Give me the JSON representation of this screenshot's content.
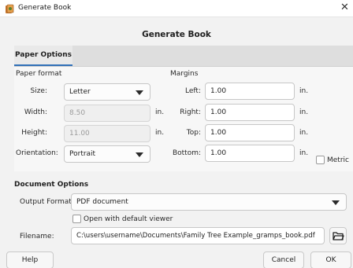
{
  "window": {
    "title": "Generate Book",
    "close_glyph": "✕"
  },
  "header": {
    "title": "Generate Book"
  },
  "tabs": [
    {
      "label": "Paper Options",
      "selected": true
    }
  ],
  "paper_format": {
    "section_label": "Paper format",
    "size_label": "Size:",
    "size_value": "Letter",
    "width_label": "Width:",
    "width_value": "8.50",
    "width_unit": "in.",
    "height_label": "Height:",
    "height_value": "11.00",
    "height_unit": "in.",
    "orientation_label": "Orientation:",
    "orientation_value": "Portrait"
  },
  "margins": {
    "section_label": "Margins",
    "left_label": "Left:",
    "left_value": "1.00",
    "left_unit": "in.",
    "right_label": "Right:",
    "right_value": "1.00",
    "right_unit": "in.",
    "top_label": "Top:",
    "top_value": "1.00",
    "top_unit": "in.",
    "bottom_label": "Bottom:",
    "bottom_value": "1.00",
    "bottom_unit": "in.",
    "metric_label": "Metric",
    "metric_checked": false
  },
  "document_options": {
    "section_title": "Document Options",
    "output_format_label": "Output Format:",
    "output_format_value": "PDF document",
    "open_default_label": "Open with default viewer",
    "open_default_checked": false,
    "filename_label": "Filename:",
    "filename_value": "C:\\users\\username\\Documents\\Family Tree Example_gramps_book.pdf"
  },
  "buttons": {
    "help": "Help",
    "cancel": "Cancel",
    "ok": "OK"
  },
  "icons": {
    "app": "gramps-book-icon",
    "close": "close-icon",
    "folder": "folder-open-icon",
    "dropdown": "chevron-down-icon"
  },
  "colors": {
    "accent": "#2f6fb7",
    "background": "#f2f2f2",
    "panel": "#f7f7f7"
  }
}
